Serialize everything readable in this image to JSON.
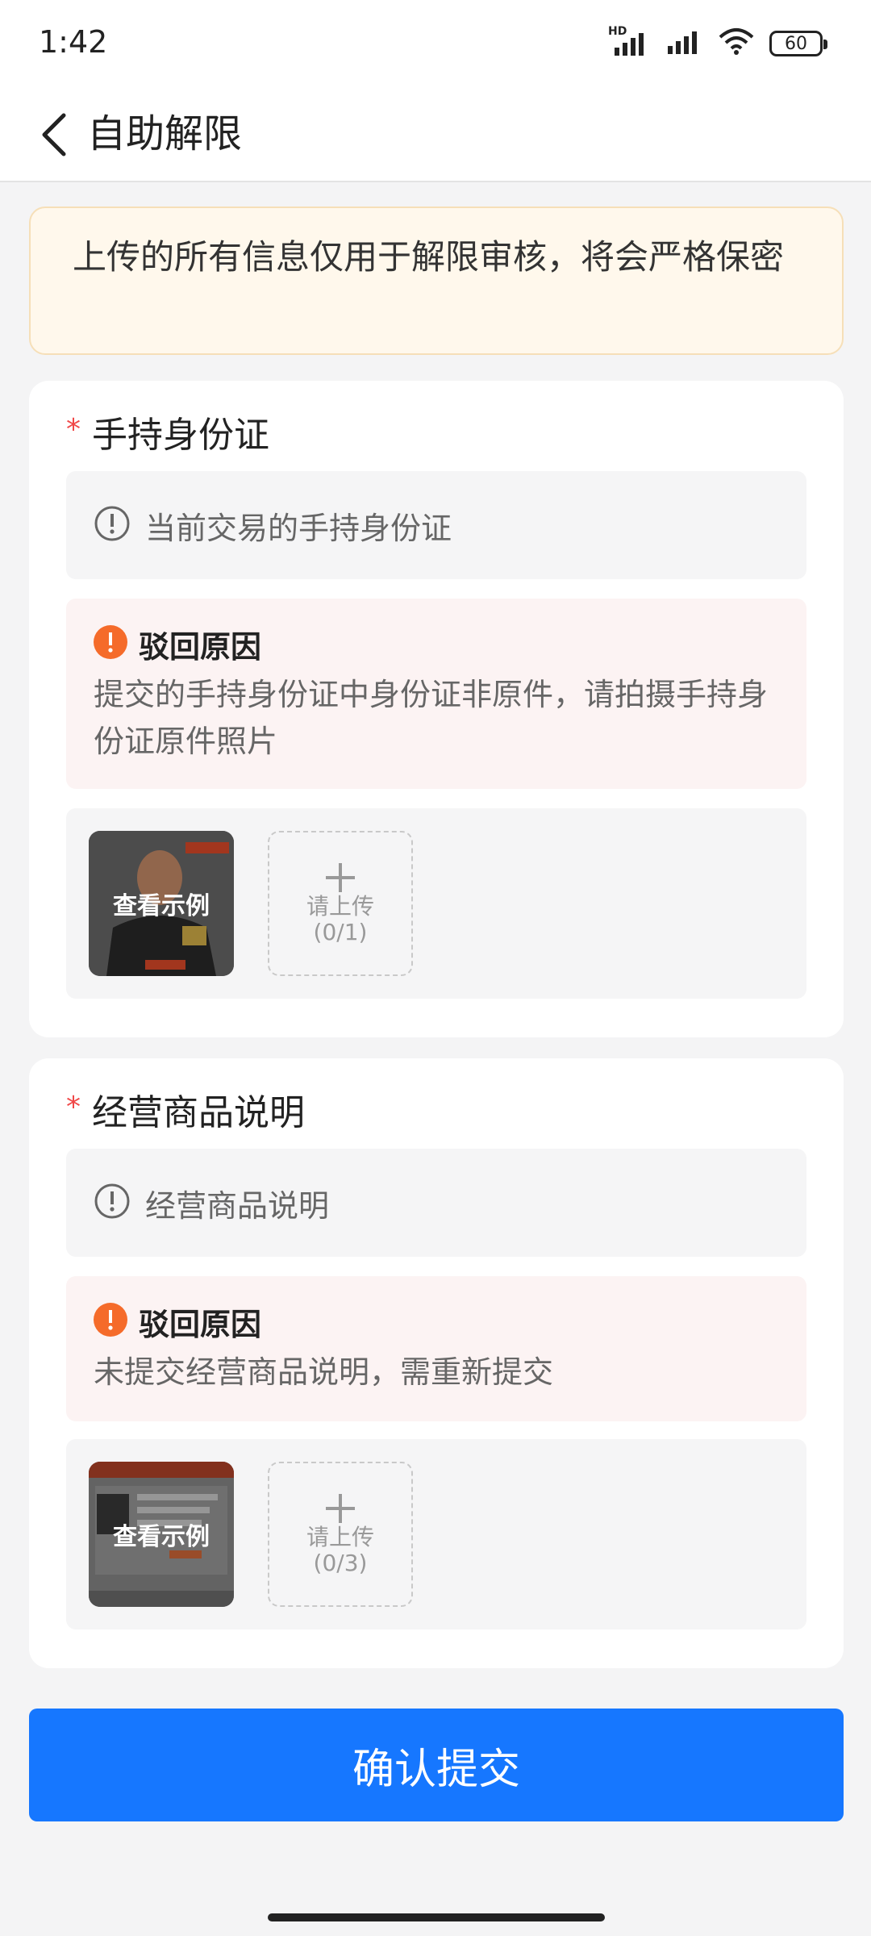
{
  "status_bar": {
    "time": "1:42",
    "battery": "60",
    "network_badge": "HD"
  },
  "nav": {
    "title": "自助解限"
  },
  "notice": {
    "text": "上传的所有信息仅用于解限审核，将会严格保密"
  },
  "sections": [
    {
      "title": "手持身份证",
      "required_mark": "*",
      "hint": "当前交易的手持身份证",
      "reject_title": "驳回原因",
      "reject_text": "提交的手持身份证中身份证非原件，请拍摄手持身份证原件照片",
      "example_label": "查看示例",
      "upload_label": "请上传",
      "upload_count": "(0/1)"
    },
    {
      "title": "经营商品说明",
      "required_mark": "*",
      "hint": "经营商品说明",
      "reject_title": "驳回原因",
      "reject_text": "未提交经营商品说明，需重新提交",
      "example_label": "查看示例",
      "upload_label": "请上传",
      "upload_count": "(0/3)"
    }
  ],
  "submit": {
    "label": "确认提交"
  },
  "colors": {
    "primary": "#1677ff",
    "warning": "#f56b2a",
    "required": "#f04848"
  }
}
